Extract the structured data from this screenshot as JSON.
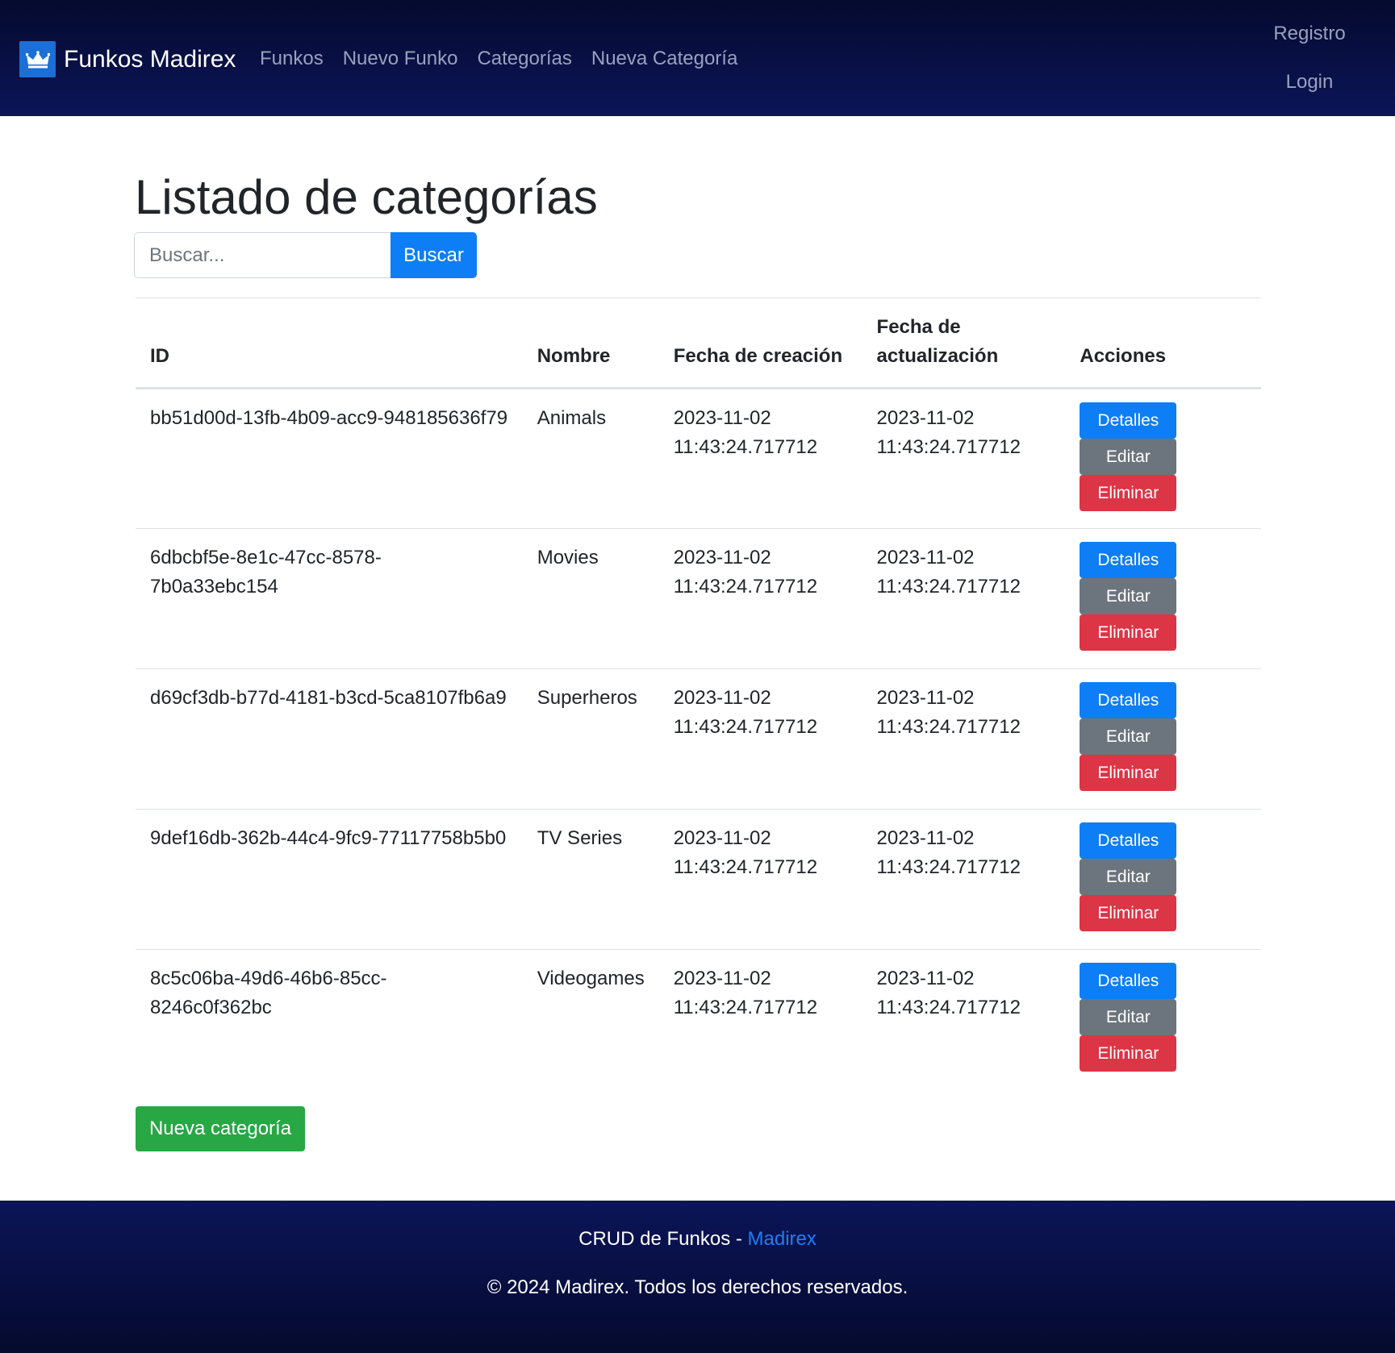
{
  "navbar": {
    "brand": "Funkos Madirex",
    "links": [
      "Funkos",
      "Nuevo Funko",
      "Categorías",
      "Nueva Categoría"
    ],
    "right_links": [
      "Registro",
      "Login"
    ]
  },
  "main": {
    "title": "Listado de categorías",
    "search": {
      "placeholder": "Buscar...",
      "button": "Buscar"
    },
    "table": {
      "headers": [
        "ID",
        "Nombre",
        "Fecha de creación",
        "Fecha de actualización",
        "Acciones"
      ],
      "rows": [
        {
          "id": "bb51d00d-13fb-4b09-acc9-948185636f79",
          "nombre": "Animals",
          "created_date": "2023-11-02",
          "created_time": "11:43:24.717712",
          "updated_date": "2023-11-02",
          "updated_time": "11:43:24.717712"
        },
        {
          "id": "6dbcbf5e-8e1c-47cc-8578-7b0a33ebc154",
          "nombre": "Movies",
          "created_date": "2023-11-02",
          "created_time": "11:43:24.717712",
          "updated_date": "2023-11-02",
          "updated_time": "11:43:24.717712"
        },
        {
          "id": "d69cf3db-b77d-4181-b3cd-5ca8107fb6a9",
          "nombre": "Superheros",
          "created_date": "2023-11-02",
          "created_time": "11:43:24.717712",
          "updated_date": "2023-11-02",
          "updated_time": "11:43:24.717712"
        },
        {
          "id": "9def16db-362b-44c4-9fc9-77117758b5b0",
          "nombre": "TV Series",
          "created_date": "2023-11-02",
          "created_time": "11:43:24.717712",
          "updated_date": "2023-11-02",
          "updated_time": "11:43:24.717712"
        },
        {
          "id": "8c5c06ba-49d6-46b6-85cc-8246c0f362bc",
          "nombre": "Videogames",
          "created_date": "2023-11-02",
          "created_time": "11:43:24.717712",
          "updated_date": "2023-11-02",
          "updated_time": "11:43:24.717712"
        }
      ],
      "actions": {
        "details": "Detalles",
        "edit": "Editar",
        "delete": "Eliminar"
      }
    },
    "new_button": "Nueva categoría"
  },
  "footer": {
    "line1_prefix": "CRUD de Funkos - ",
    "line1_link": "Madirex",
    "line2": "© 2024 Madirex. Todos los derechos reservados."
  },
  "colors": {
    "navbar": "#0b1558",
    "primary": "#0d7ef5",
    "secondary": "#6c757d",
    "danger": "#dc3545",
    "success": "#28a745"
  },
  "icons": {
    "brand": "crown-icon"
  }
}
